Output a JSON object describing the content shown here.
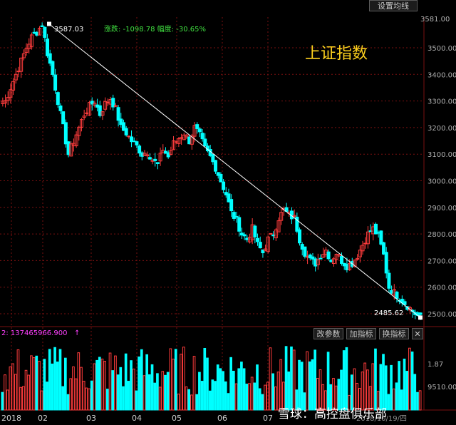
{
  "toolbar": {
    "ma_settings_label": "设置均线",
    "change_params_label": "改参数",
    "add_indicator_label": "加指标",
    "switch_indicator_label": "换指标",
    "close_label": "✕"
  },
  "annotations": {
    "high_label": "3587.03",
    "low_label": "2485.62",
    "change_text": "涨跌: -1098.78  幅度: -30.65%",
    "volume_readout": "2: 137465966.900"
  },
  "watermark": "雪球：高控盘俱乐部",
  "colors": {
    "up": "#ff3c3c",
    "down": "#00ffff",
    "grid": "#7a1010",
    "trend": "#ffffff",
    "title": "#ffd21e",
    "volume_label": "#ff40ff",
    "change_text": "#40e040"
  },
  "chart_data": [
    {
      "type": "candlestick",
      "title": "上证指数",
      "y_ticks": [
        2500,
        2600,
        2700,
        2800,
        2900,
        3000,
        3100,
        3200,
        3300,
        3400,
        3500
      ],
      "ylim": [
        2485.62,
        3587.03
      ],
      "y_axis_top_label": "3581.00",
      "x_ticks": [
        "2018",
        "02",
        "03",
        "04",
        "05",
        "06",
        "07"
      ],
      "x_tick_bottom_right": "2018/10/19/四",
      "grid": true,
      "trend_line": {
        "from": 3587.03,
        "to": 2485.62
      },
      "series": [
        {
          "month": "2018-01",
          "close": [
            3300,
            3350,
            3400,
            3450,
            3500,
            3540,
            3560,
            3587
          ]
        },
        {
          "month": "2018-02",
          "close": [
            3480,
            3400,
            3300,
            3200,
            3100,
            3150,
            3200,
            3250
          ]
        },
        {
          "month": "2018-03",
          "close": [
            3280,
            3300,
            3250,
            3290,
            3310,
            3270,
            3200,
            3180
          ]
        },
        {
          "month": "2018-04",
          "close": [
            3150,
            3130,
            3100,
            3110,
            3080,
            3060,
            3120,
            3090
          ]
        },
        {
          "month": "2018-05",
          "close": [
            3140,
            3160,
            3180,
            3150,
            3200,
            3170,
            3120,
            3090
          ]
        },
        {
          "month": "2018-06",
          "close": [
            3050,
            3000,
            2950,
            2880,
            2850,
            2800,
            2780,
            2820
          ]
        },
        {
          "month": "2018-07",
          "close": [
            2760,
            2730,
            2780,
            2800,
            2860,
            2890,
            2870,
            2860
          ]
        },
        {
          "month": "2018-08",
          "close": [
            2780,
            2730,
            2700,
            2690,
            2720,
            2740,
            2700,
            2730
          ]
        },
        {
          "month": "2018-09",
          "close": [
            2700,
            2680,
            2690,
            2720,
            2760,
            2800,
            2820,
            2790
          ]
        },
        {
          "month": "2018-10",
          "close": [
            2720,
            2600,
            2580,
            2560,
            2540,
            2520,
            2500,
            2485
          ]
        }
      ]
    },
    {
      "type": "bar",
      "title": "",
      "y_ticks": [
        "1.87",
        "9510.00"
      ],
      "series": [
        {
          "name": "volume",
          "values": "relative"
        }
      ]
    }
  ]
}
